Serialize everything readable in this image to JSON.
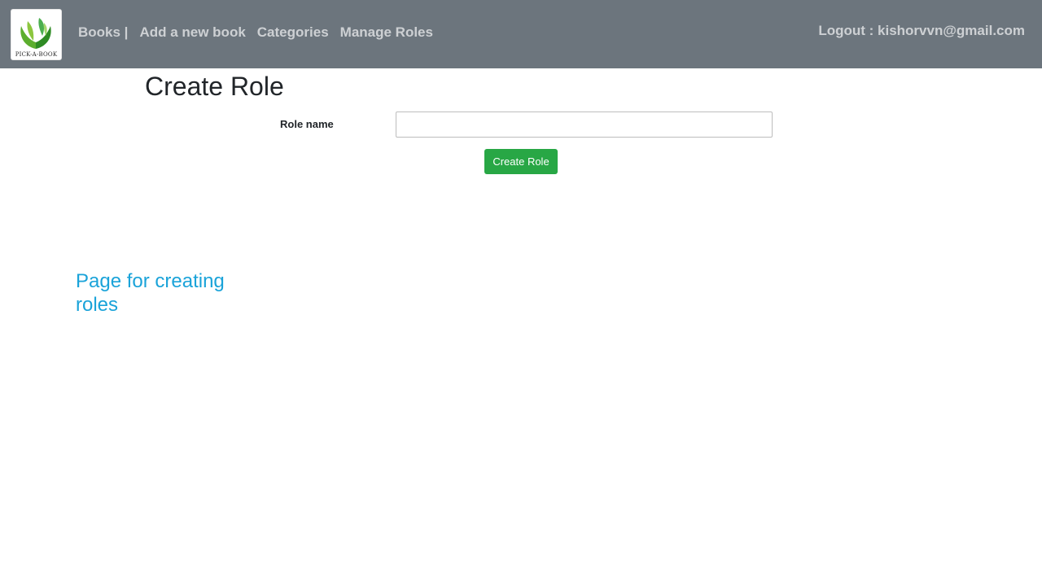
{
  "brand": {
    "logo_text": "PICK-A-BOOK"
  },
  "nav": {
    "items": [
      {
        "label": "Books |"
      },
      {
        "label": "Add a new book"
      },
      {
        "label": "Categories"
      },
      {
        "label": "Manage Roles"
      }
    ],
    "logout_label": "Logout : kishorvvn@gmail.com"
  },
  "page": {
    "title": "Create Role"
  },
  "form": {
    "role_name_label": "Role name",
    "role_name_value": "",
    "submit_label": "Create Role"
  },
  "annotation": {
    "text": "Page for creating roles"
  },
  "colors": {
    "navbar": "#6c757d",
    "button": "#28a745",
    "annotation": "#1aa3d9"
  }
}
